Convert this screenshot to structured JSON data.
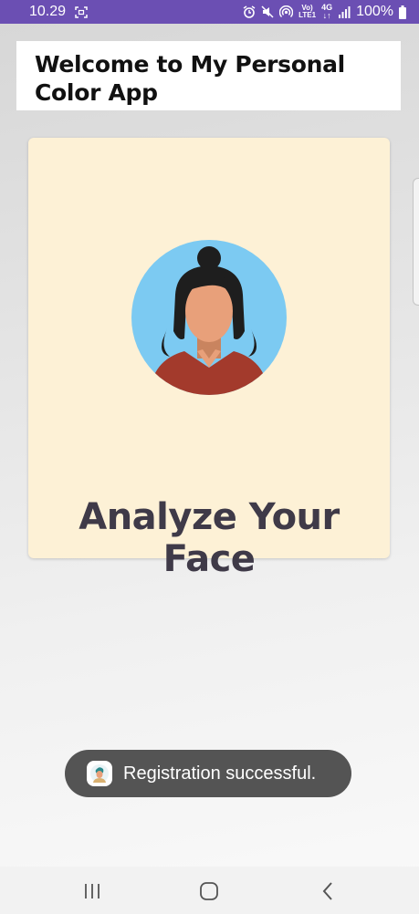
{
  "status_bar": {
    "time": "10.29",
    "volte_top": "Vo)",
    "volte_bottom": "LTE1",
    "network": "4G",
    "battery": "100%",
    "icons": [
      "screenshot-icon",
      "alarm-icon",
      "mute-icon",
      "hotspot-icon",
      "volte-icon",
      "network-4g-icon",
      "signal-icon",
      "battery-icon"
    ]
  },
  "header": {
    "title": "Welcome to My Personal Color App"
  },
  "card": {
    "image": "woman-avatar-illustration",
    "heading": "Analyze Your Face"
  },
  "toast": {
    "icon": "app-icon",
    "message": "Registration successful."
  },
  "nav_bar": {
    "icons": [
      "recent-apps-icon",
      "home-icon",
      "back-icon"
    ]
  },
  "colors": {
    "status_bar": "#6b4fb3",
    "card_bg": "#fdf1d6",
    "heading": "#3f3a48",
    "toast_bg": "#545454",
    "avatar_bg": "#7ccaf2",
    "hair": "#1e1e1e",
    "skin": "#e8a07a",
    "shirt": "#a33a2c"
  }
}
